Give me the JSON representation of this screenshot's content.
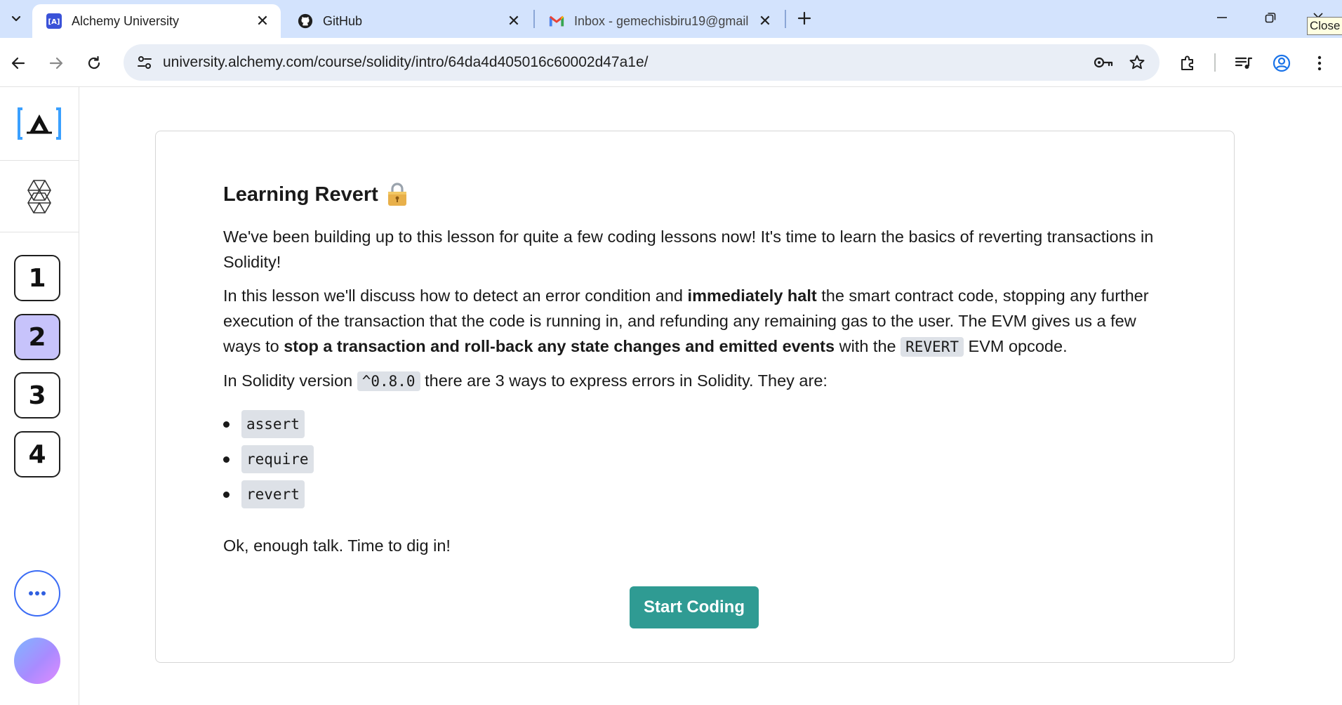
{
  "browser": {
    "tabs": [
      {
        "title": "Alchemy University",
        "favicon": "alchemy-favicon",
        "active": true
      },
      {
        "title": "GitHub",
        "favicon": "github-favicon",
        "active": false
      },
      {
        "title": "Inbox - gemechisbiru19@gmail",
        "favicon": "gmail-favicon",
        "active": false
      }
    ],
    "url": "university.alchemy.com/course/solidity/intro/64da4d405016c60002d47a1e/",
    "tooltip": "Close"
  },
  "sidebar": {
    "logo": "[A]",
    "steps": [
      {
        "label": "1",
        "current": false
      },
      {
        "label": "2",
        "current": true
      },
      {
        "label": "3",
        "current": false
      },
      {
        "label": "4",
        "current": false
      }
    ]
  },
  "lesson": {
    "title": "Learning Revert",
    "title_icon": "lock-emoji",
    "p1": "We've been building up to this lesson for quite a few coding lessons now! It's time to learn the basics of reverting transactions in Solidity!",
    "p2_a": "In this lesson we'll discuss how to detect an error condition and ",
    "p2_b": "immediately halt",
    "p2_c": " the smart contract code, stopping any further execution of the transaction that the code is running in, and refunding any remaining gas to the user. The EVM gives us a few ways to ",
    "p2_d": "stop a transaction and roll-back any state changes and emitted events",
    "p2_e": " with the ",
    "p2_code": "REVERT",
    "p2_f": " EVM opcode.",
    "p3_a": "In Solidity version ",
    "p3_code": "^0.8.0",
    "p3_b": " there are 3 ways to express errors in Solidity. They are:",
    "ways": [
      "assert",
      "require",
      "revert"
    ],
    "closing": "Ok, enough talk. Time to dig in!",
    "start_button": "Start Coding"
  },
  "colors": {
    "tabstrip": "#d3e3fd",
    "accent_button": "#2f9b93",
    "current_step": "#c7c3fb",
    "more_button_border": "#3b6cf5"
  }
}
